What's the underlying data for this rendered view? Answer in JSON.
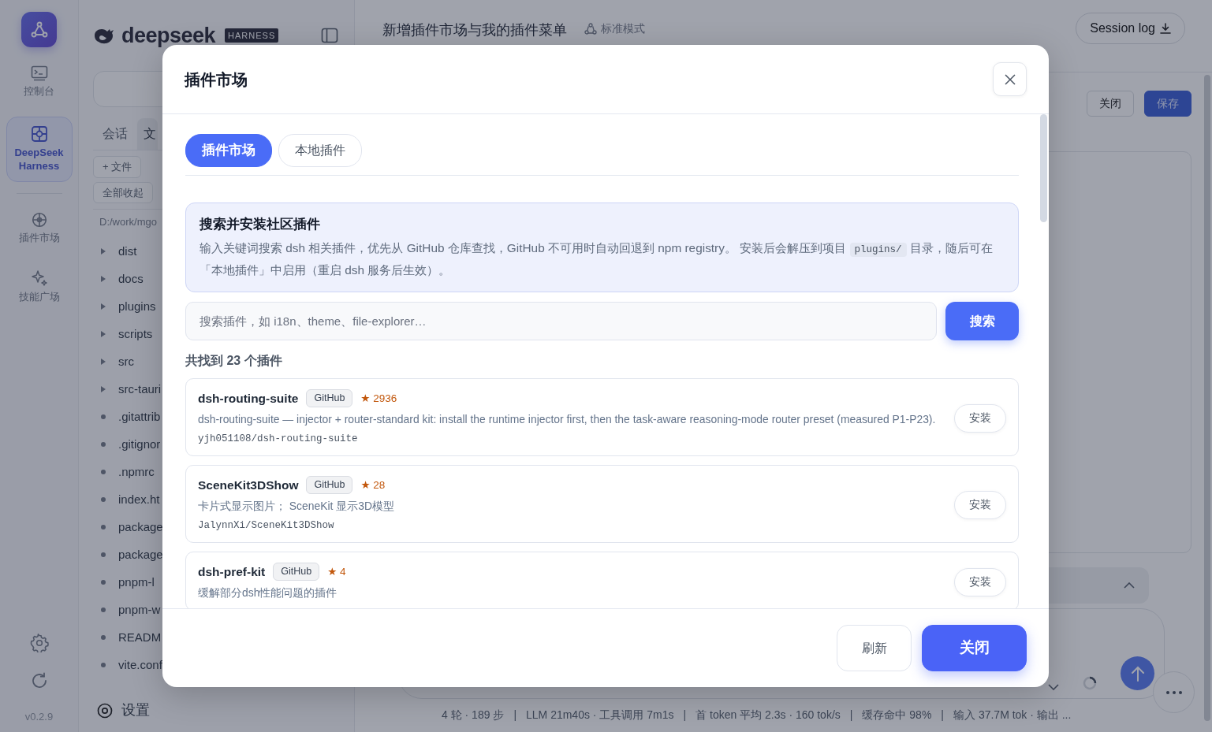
{
  "rail": {
    "items": [
      {
        "label": "控制台",
        "kind": "console",
        "selected": false
      },
      {
        "label": "DeepSeek Harness",
        "kind": "harness",
        "selected": true
      },
      {
        "label": "插件市场",
        "kind": "market",
        "selected": false
      },
      {
        "label": "技能广场",
        "kind": "skills",
        "selected": false
      }
    ],
    "version": "v0.2.9"
  },
  "file_panel": {
    "logo_text": "deepseek",
    "logo_badge": "HARNESS",
    "tabs": [
      {
        "label": "会话",
        "selected": false
      },
      {
        "label": "文",
        "selected": true
      }
    ],
    "actions": [
      "+ 文件",
      "全部收起"
    ],
    "path": "D:/work/mgo",
    "tree": [
      {
        "name": "dist",
        "kind": "folder"
      },
      {
        "name": "docs",
        "kind": "folder"
      },
      {
        "name": "plugins",
        "kind": "folder"
      },
      {
        "name": "scripts",
        "kind": "folder"
      },
      {
        "name": "src",
        "kind": "folder"
      },
      {
        "name": "src-tauri",
        "kind": "folder"
      },
      {
        "name": ".gitattrib",
        "kind": "file"
      },
      {
        "name": ".gitignor",
        "kind": "file"
      },
      {
        "name": ".npmrc",
        "kind": "file"
      },
      {
        "name": "index.ht",
        "kind": "file"
      },
      {
        "name": "package",
        "kind": "file"
      },
      {
        "name": "package",
        "kind": "file"
      },
      {
        "name": "pnpm-l",
        "kind": "file"
      },
      {
        "name": "pnpm-w",
        "kind": "file"
      },
      {
        "name": "READM",
        "kind": "file"
      },
      {
        "name": "vite.conf",
        "kind": "file"
      }
    ],
    "footer": "设置"
  },
  "main": {
    "title": "新增插件市场与我的插件菜单",
    "mode": "标准模式",
    "session_button": "Session log",
    "toolbar": [
      {
        "label": "关闭",
        "kind": "secondary"
      },
      {
        "label": "保存",
        "kind": "primary"
      }
    ],
    "status_bar": {
      "separator": "|",
      "segments": [
        "4 轮 · 189 步",
        "LLM 21m40s · 工具调用 7m1s",
        "首 token 平均 2.3s · 160 tok/s",
        "缓存命中 98%",
        "输入 37.7M tok · 输出 ..."
      ]
    }
  },
  "modal": {
    "title": "插件市场",
    "tabs": [
      {
        "label": "插件市场",
        "selected": true
      },
      {
        "label": "本地插件",
        "selected": false
      }
    ],
    "info": {
      "title": "搜索并安装社区插件",
      "description": [
        {
          "kind": "text",
          "text": "输入关键词搜索 dsh 相关插件，优先从 GitHub 仓库查找，GitHub 不可用时自动回退到 npm registry。 安装后会解压到项目 "
        },
        {
          "kind": "code",
          "text": "plugins/"
        },
        {
          "kind": "text",
          "text": " 目录，随后可在「本地插件」中启用（重启 dsh 服务后生效）。"
        }
      ]
    },
    "search": {
      "placeholder": "搜索插件，如 i18n、theme、file-explorer…",
      "button": "搜索"
    },
    "result_count": "共找到 23 个插件",
    "plugins": [
      {
        "name": "dsh-routing-suite",
        "source": "GitHub",
        "stars": "★ 2936",
        "description": "dsh-routing-suite — injector + router-standard kit: install the runtime injector first, then the task-aware reasoning-mode router preset (measured P1-P23).",
        "repo": "yjh051108/dsh-routing-suite",
        "button": "安装"
      },
      {
        "name": "SceneKit3DShow",
        "source": "GitHub",
        "stars": "★ 28",
        "description": "卡片式显示图片； SceneKit 显示3D模型",
        "repo": "JalynnXi/SceneKit3DShow",
        "button": "安装"
      },
      {
        "name": "dsh-pref-kit",
        "source": "GitHub",
        "stars": "★ 4",
        "description": "缓解部分dsh性能问题的插件",
        "button": "安装"
      }
    ],
    "footer_buttons": [
      {
        "label": "刷新",
        "kind": "secondary"
      },
      {
        "label": "关闭",
        "kind": "primary"
      }
    ]
  }
}
